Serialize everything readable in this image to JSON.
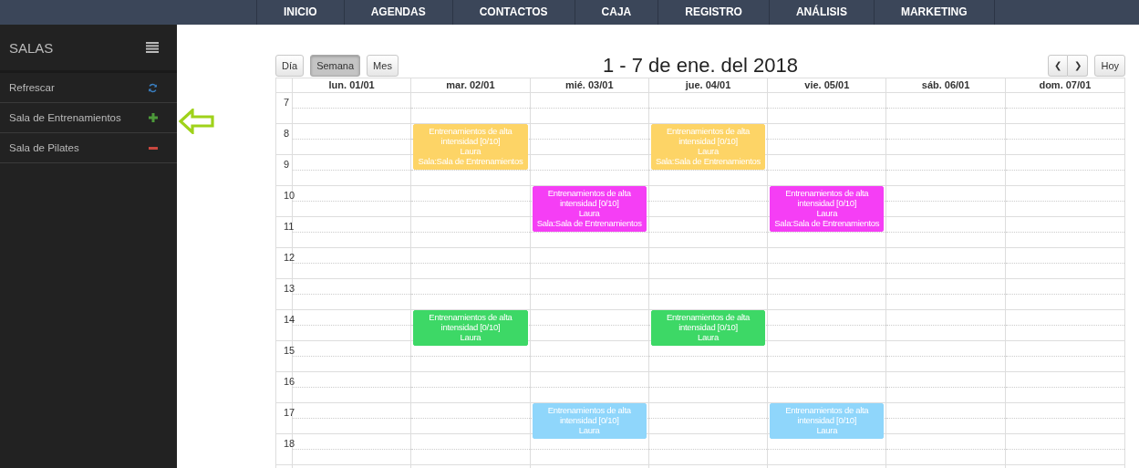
{
  "nav": [
    "INICIO",
    "AGENDAS",
    "CONTACTOS",
    "CAJA",
    "REGISTRO",
    "ANÁLISIS",
    "MARKETING"
  ],
  "sidebar": {
    "title": "SALAS",
    "items": [
      {
        "label": "Refrescar",
        "kind": "refresh"
      },
      {
        "label": "Sala de Entrenamientos",
        "kind": "add"
      },
      {
        "label": "Sala de Pilates",
        "kind": "remove"
      }
    ]
  },
  "calendar": {
    "title": "1 - 7 de ene. del 2018",
    "views": [
      {
        "label": "Día",
        "selected": false
      },
      {
        "label": "Semana",
        "selected": true
      },
      {
        "label": "Mes",
        "selected": false
      }
    ],
    "prev": "❮",
    "next": "❯",
    "today": "Hoy",
    "days": [
      "lun. 01/01",
      "mar. 02/01",
      "mié. 03/01",
      "jue. 04/01",
      "vie. 05/01",
      "sáb. 06/01",
      "dom. 07/01"
    ],
    "hours": [
      {
        "label": "7"
      },
      {
        "label": "8",
        "cells": [
          {
            "kind": "empty"
          },
          {
            "kind": "event",
            "color": "#fdd466",
            "lines": [
              "Entrenamientos de alta intensidad [0/10]",
              "Laura",
              "Sala:Sala de Entrenamientos"
            ]
          },
          {
            "kind": "empty"
          },
          {
            "kind": "event",
            "color": "#fdd466",
            "lines": [
              "Entrenamientos de alta intensidad [0/10]",
              "Laura",
              "Sala:Sala de Entrenamientos"
            ]
          }
        ]
      },
      {
        "label": "9"
      },
      {
        "label": "10",
        "cells": [
          {
            "kind": "empty"
          },
          {
            "kind": "empty"
          },
          {
            "kind": "event",
            "color": "#f53ef5",
            "lines": [
              "Entrenamientos de alta intensidad [0/10]",
              "Laura",
              "Sala:Sala de Entrenamientos"
            ]
          },
          {
            "kind": "empty"
          },
          {
            "kind": "event",
            "color": "#f53ef5",
            "lines": [
              "Entrenamientos de alta intensidad [0/10]",
              "Laura",
              "Sala:Sala de Entrenamientos"
            ]
          }
        ]
      },
      {
        "label": "11"
      },
      {
        "label": "12"
      },
      {
        "label": "13"
      },
      {
        "label": "14",
        "cells": [
          {
            "kind": "empty"
          },
          {
            "kind": "event",
            "color": "#3dd866",
            "lines": [
              "Entrenamientos de alta intensidad [0/10]",
              "Laura"
            ]
          },
          {
            "kind": "empty"
          },
          {
            "kind": "event",
            "color": "#3dd866",
            "lines": [
              "Entrenamientos de alta intensidad [0/10]",
              "Laura"
            ]
          }
        ]
      },
      {
        "label": "15"
      },
      {
        "label": "16"
      },
      {
        "label": "17",
        "cells": [
          {
            "kind": "empty"
          },
          {
            "kind": "empty"
          },
          {
            "kind": "event",
            "color": "#8fd6fb",
            "lines": [
              "Entrenamientos de alta intensidad [0/10]",
              "Laura"
            ]
          },
          {
            "kind": "empty"
          },
          {
            "kind": "event",
            "color": "#8fd6fb",
            "lines": [
              "Entrenamientos de alta intensidad [0/10]",
              "Laura"
            ]
          }
        ]
      },
      {
        "label": "18"
      }
    ]
  }
}
